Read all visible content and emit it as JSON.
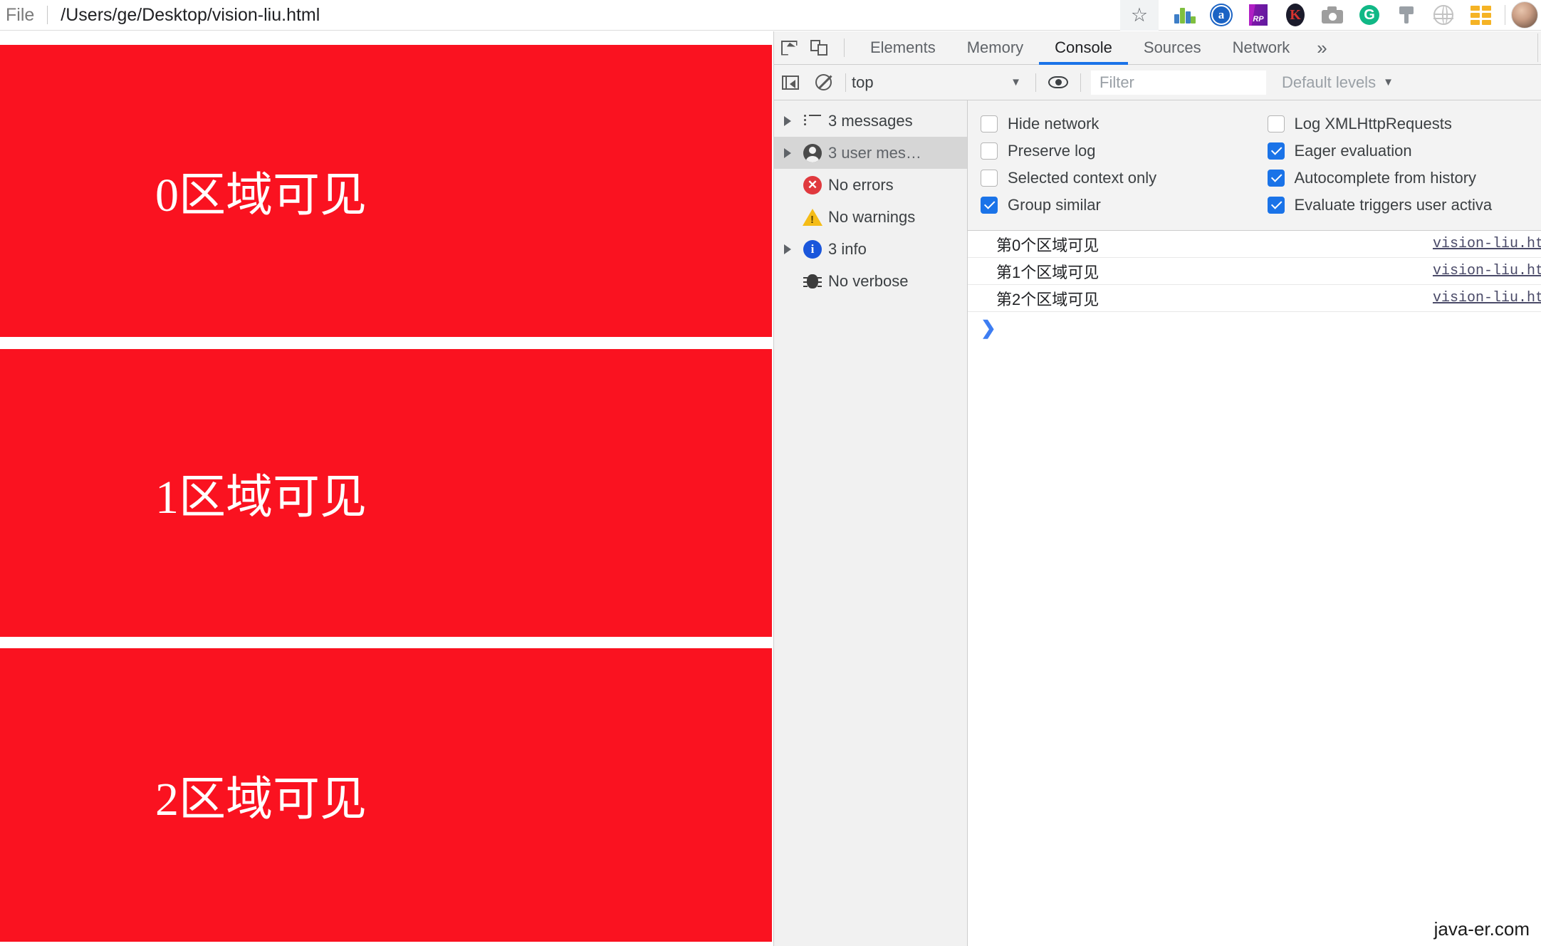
{
  "browser": {
    "scheme_label": "File",
    "url": "/Users/ge/Desktop/vision-liu.html",
    "toolbar_icons": [
      {
        "name": "bookmark-star-icon",
        "glyph": "☆"
      },
      {
        "name": "chart-extension-icon",
        "glyph": ""
      },
      {
        "name": "alexa-extension-icon",
        "glyph": "a"
      },
      {
        "name": "rp-extension-icon",
        "glyph": "RP"
      },
      {
        "name": "kami-extension-icon",
        "glyph": "K"
      },
      {
        "name": "screenshot-camera-icon",
        "glyph": ""
      },
      {
        "name": "grammarly-extension-icon",
        "glyph": "G"
      },
      {
        "name": "pin-extension-icon",
        "glyph": ""
      },
      {
        "name": "globe-extension-icon",
        "glyph": ""
      },
      {
        "name": "grid-extension-icon",
        "glyph": ""
      },
      {
        "name": "profile-avatar",
        "glyph": ""
      }
    ]
  },
  "page": {
    "panels": [
      {
        "text": "0区域可见",
        "color": "#fa1220"
      },
      {
        "text": "1区域可见",
        "color": "#fa1220"
      },
      {
        "text": "2区域可见",
        "color": "#fa1220"
      }
    ]
  },
  "devtools": {
    "tabs": [
      {
        "label": "Elements",
        "active": false
      },
      {
        "label": "Memory",
        "active": false
      },
      {
        "label": "Console",
        "active": true
      },
      {
        "label": "Sources",
        "active": false
      },
      {
        "label": "Network",
        "active": false
      }
    ],
    "more_tabs_glyph": "»",
    "active_tab_color": "#1a73e8",
    "console_toolbar": {
      "context": "top",
      "context_caret": "▼",
      "filter_placeholder": "Filter",
      "filter_value": "",
      "levels": "Default levels",
      "levels_caret": "▼"
    },
    "sidebar": [
      {
        "label": "3 messages",
        "icon": "list-icon",
        "expandable": true,
        "selected": false
      },
      {
        "label": "3 user mes…",
        "icon": "user-icon",
        "expandable": true,
        "selected": true
      },
      {
        "label": "No errors",
        "icon": "error-icon",
        "expandable": false,
        "selected": false
      },
      {
        "label": "No warnings",
        "icon": "warning-icon",
        "expandable": false,
        "selected": false
      },
      {
        "label": "3 info",
        "icon": "info-icon",
        "expandable": true,
        "selected": false
      },
      {
        "label": "No verbose",
        "icon": "bug-icon",
        "expandable": false,
        "selected": false
      }
    ],
    "settings_left": [
      {
        "label": "Hide network",
        "checked": false
      },
      {
        "label": "Preserve log",
        "checked": false
      },
      {
        "label": "Selected context only",
        "checked": false
      },
      {
        "label": "Group similar",
        "checked": true
      }
    ],
    "settings_right": [
      {
        "label": "Log XMLHttpRequests",
        "checked": false
      },
      {
        "label": "Eager evaluation",
        "checked": true
      },
      {
        "label": "Autocomplete from history",
        "checked": true
      },
      {
        "label": "Evaluate triggers user activa",
        "checked": true
      }
    ],
    "logs": [
      {
        "message": "第0个区域可见",
        "source": "vision-liu.htm"
      },
      {
        "message": "第1个区域可见",
        "source": "vision-liu.htm"
      },
      {
        "message": "第2个区域可见",
        "source": "vision-liu.htm"
      }
    ],
    "prompt_glyph": "❯"
  },
  "watermark": "java-er.com"
}
